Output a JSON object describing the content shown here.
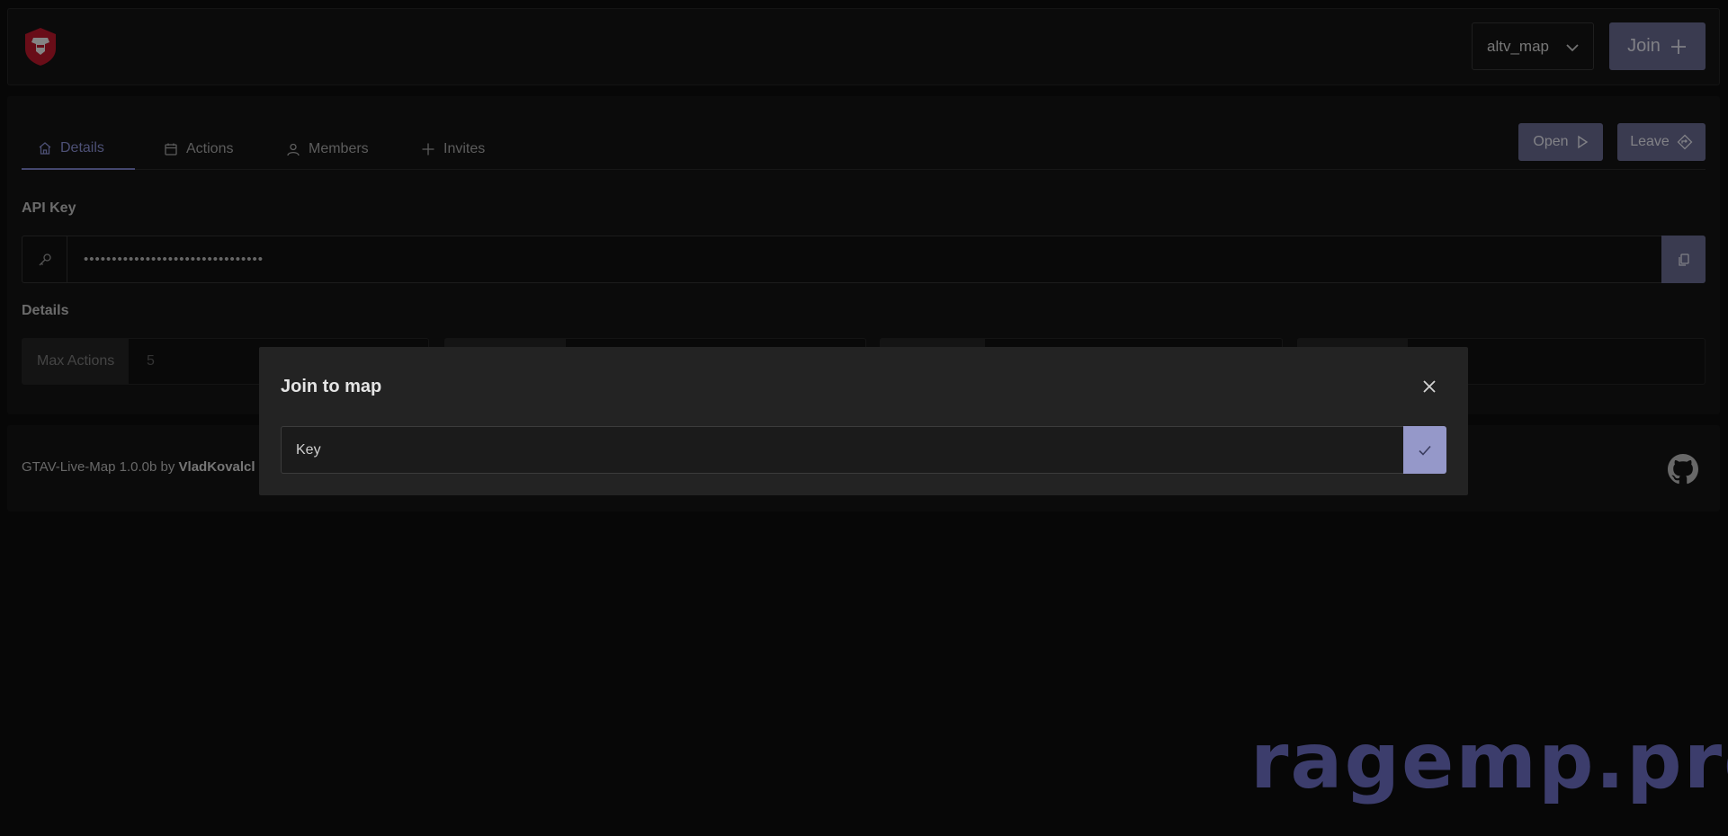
{
  "header": {
    "map_select_value": "altv_map",
    "join_label": "Join"
  },
  "tabs": [
    {
      "label": "Details"
    },
    {
      "label": "Actions"
    },
    {
      "label": "Members"
    },
    {
      "label": "Invites"
    }
  ],
  "actions": {
    "open_label": "Open",
    "leave_label": "Leave"
  },
  "api_key": {
    "label": "API Key",
    "value": "••••••••••••••••••••••••••••••••"
  },
  "details": {
    "label": "Details",
    "fields": [
      {
        "label": "Max Actions",
        "value": "5"
      }
    ]
  },
  "footer": {
    "prefix": "GTAV-Live-Map 1.0.0b by ",
    "author": "VladKovalcl"
  },
  "modal": {
    "title": "Join to map",
    "input_placeholder": "Key"
  },
  "watermark": "ragemp.pro",
  "colors": {
    "accent": "#6a6c93",
    "accent_light": "#9598c9",
    "tab_active": "#8c92d6",
    "logo_red": "#c0192c"
  }
}
